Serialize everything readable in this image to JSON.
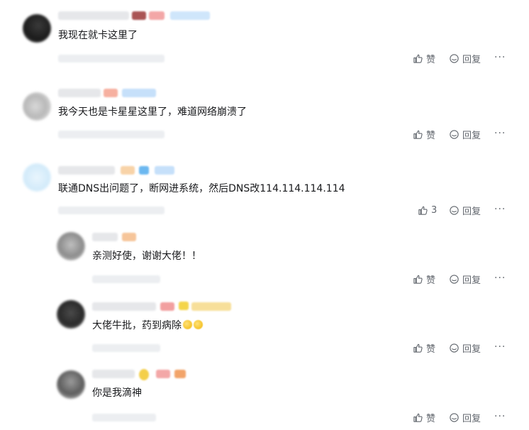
{
  "comments": [
    {
      "text": "我现在就卡这里了",
      "like_label": "赞",
      "reply_label": "回复",
      "more_label": "···"
    },
    {
      "text": "我今天也是卡星星这里了，难道网络崩溃了",
      "like_label": "赞",
      "reply_label": "回复",
      "more_label": "···"
    },
    {
      "text": "联通DNS出问题了，断网进系统，然后DNS改114.114.114.114",
      "like_count": "3",
      "reply_label": "回复",
      "more_label": "···",
      "replies": [
        {
          "text": "亲测好使，谢谢大佬！！",
          "like_label": "赞",
          "reply_label": "回复",
          "more_label": "···"
        },
        {
          "text": "大佬牛批，药到病除",
          "like_label": "赞",
          "reply_label": "回复",
          "more_label": "···"
        },
        {
          "text": "你是我滴神",
          "like_label": "赞",
          "reply_label": "回复",
          "more_label": "···"
        }
      ]
    }
  ],
  "colors": {
    "text": "#18191c",
    "action": "#61666d",
    "meta_placeholder": "#e6e7ea"
  },
  "icons": {
    "like": "thumbs-up-icon",
    "reply": "reply-bubble-icon",
    "more": "more-dots-icon"
  }
}
